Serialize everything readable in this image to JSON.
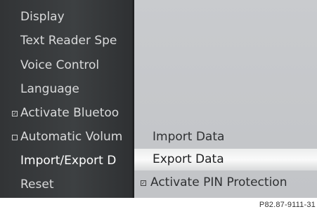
{
  "left_menu": {
    "items": [
      {
        "label": "Display"
      },
      {
        "label": "Text Reader Spe"
      },
      {
        "label": "Voice Control"
      },
      {
        "label": "Language"
      },
      {
        "label": "Activate Bluetoo",
        "checkbox": "checked"
      },
      {
        "label": "Automatic Volum",
        "checkbox": "unchecked"
      },
      {
        "label": "Import/Export D",
        "active": true
      },
      {
        "label": "Reset"
      }
    ]
  },
  "submenu": {
    "items": [
      {
        "label": "Import Data"
      },
      {
        "label": "Export Data",
        "highlighted": true
      },
      {
        "label": "Activate PIN Protection",
        "checkbox": "checked"
      }
    ]
  },
  "reference_code": "P82.87-9111-31"
}
